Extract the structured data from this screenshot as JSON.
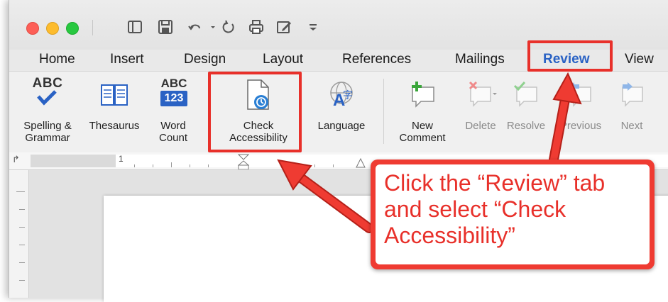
{
  "tabs": [
    "Home",
    "Insert",
    "Design",
    "Layout",
    "References",
    "Mailings",
    "Review",
    "View"
  ],
  "active_tab": "Review",
  "ribbon": {
    "spelling": {
      "icon_text": "ABC",
      "label1": "Spelling &",
      "label2": "Grammar"
    },
    "thesaurus": {
      "label": "Thesaurus"
    },
    "word_count": {
      "icon_top": "ABC",
      "icon_bottom": "123",
      "label1": "Word",
      "label2": "Count"
    },
    "check_accessibility": {
      "label1": "Check",
      "label2": "Accessibility"
    },
    "language": {
      "label": "Language"
    },
    "new_comment": {
      "label1": "New",
      "label2": "Comment"
    },
    "delete": {
      "label": "Delete"
    },
    "resolve": {
      "label": "Resolve"
    },
    "previous": {
      "label": "Previous"
    },
    "next": {
      "label": "Next"
    }
  },
  "ruler": {
    "mark": "1"
  },
  "annotation": {
    "text": "Click the “Review” tab and select “Check Accessibility”",
    "color": "#e8302a"
  },
  "colors": {
    "accent_tab": "#2a62c4",
    "annotation": "#e8302a",
    "close": "#fd5f57",
    "minimize": "#fdbc2e",
    "zoom": "#28c840"
  },
  "icons": [
    "undo-icon",
    "redo-icon",
    "print-icon",
    "save-icon",
    "sidebar-icon",
    "customize-icon"
  ]
}
